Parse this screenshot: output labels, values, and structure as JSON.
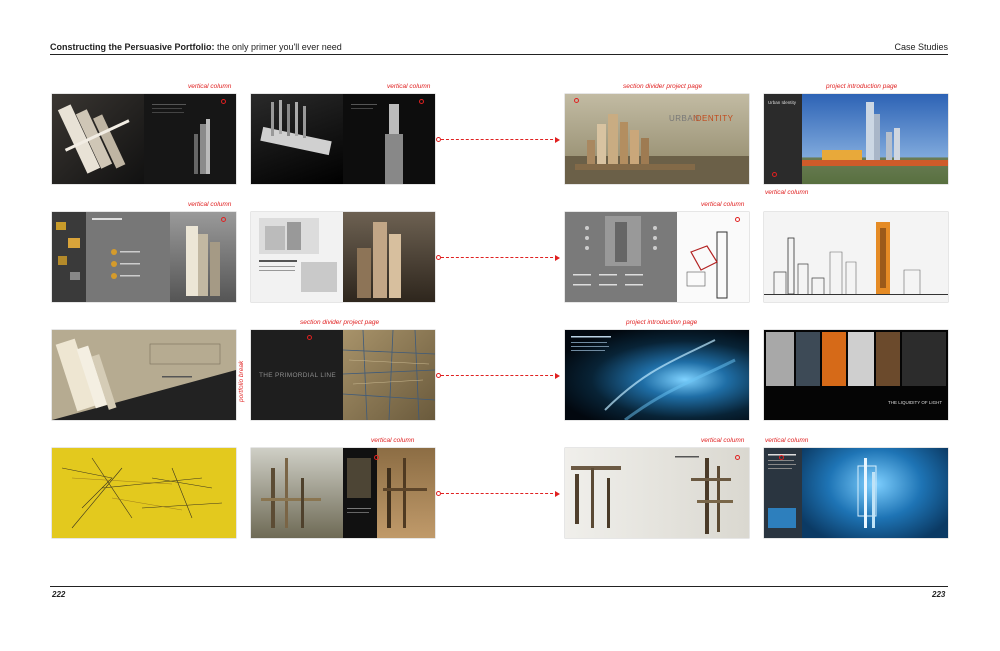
{
  "header": {
    "title_bold": "Constructing the Persuasive Portfolio:",
    "title_rest": " the only primer you'll ever need",
    "section": "Case Studies"
  },
  "footer": {
    "left_page": "222",
    "right_page": "223"
  },
  "labels": {
    "vertical_column": "vertical column",
    "section_divider": "section divider project page",
    "project_intro": "project introduction page",
    "portfolio_break": "portfolio break"
  },
  "spreads": {
    "urban_identity": {
      "line1": "URBAN",
      "line2": "IDENTITY",
      "intro_title": "Urban Identity"
    },
    "primordial_line": {
      "title": "THE PRIMORDIAL LINE"
    },
    "liquidity_of_light": {
      "title": "THE LIQUIDITY OF LIGHT"
    }
  },
  "colors": {
    "annotation": "#e02020"
  }
}
